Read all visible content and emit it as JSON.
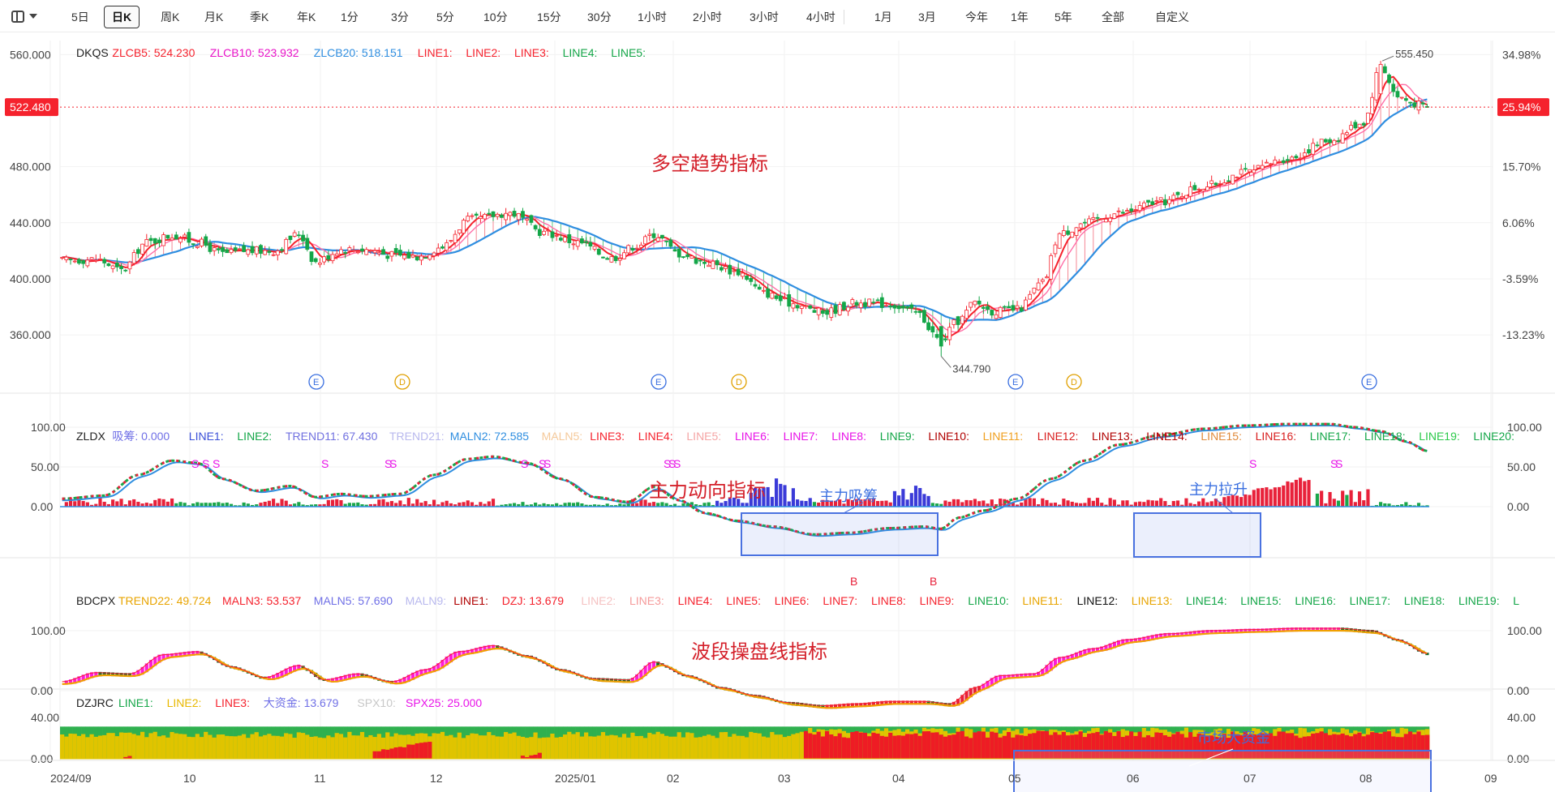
{
  "toolbar": {
    "periods": [
      "5日",
      "日K",
      "周K",
      "月K",
      "季K",
      "年K",
      "1分",
      "3分",
      "5分",
      "10分",
      "15分",
      "30分",
      "1小时",
      "2小时",
      "3小时",
      "4小时"
    ],
    "active": "日K",
    "ranges": [
      "1月",
      "3月",
      "今年",
      "1年",
      "5年",
      "全部",
      "自定义"
    ]
  },
  "colors": {
    "up": "#f5222d",
    "down": "#14a648",
    "ma5": "#f5222d",
    "ma10": "#e74c8b",
    "ma20": "#2f8ee0",
    "accent_blue": "#3a6fe0",
    "magenta": "#e812e8"
  },
  "main_panel": {
    "legend": [
      {
        "text": "DKQS",
        "color": "#222"
      },
      {
        "text": "ZLCB5: 524.230",
        "color": "#f5222d"
      },
      {
        "text": "ZLCB10: 523.932",
        "color": "#e812c8"
      },
      {
        "text": "ZLCB20: 518.151",
        "color": "#2f8ee0"
      },
      {
        "text": "LINE1:",
        "color": "#f5222d"
      },
      {
        "text": "LINE2:",
        "color": "#f5222d"
      },
      {
        "text": "LINE3:",
        "color": "#f5222d"
      },
      {
        "text": "LINE4:",
        "color": "#14a648"
      },
      {
        "text": "LINE5:",
        "color": "#14a648"
      }
    ],
    "title": "多空趋势指标",
    "y_ticks": [
      "560.000",
      "480.000",
      "440.000",
      "400.000",
      "360.000"
    ],
    "pct_ticks": [
      "34.98%",
      "15.70%",
      "6.06%",
      "-3.59%",
      "-13.23%"
    ],
    "current_price": "522.480",
    "current_pct": "25.94%",
    "high_label": "555.450",
    "low_label": "344.790",
    "event_markers": [
      "E",
      "D",
      "E",
      "D",
      "E",
      "D",
      "E"
    ]
  },
  "zldx_panel": {
    "legend": [
      {
        "text": "ZLDX",
        "color": "#222"
      },
      {
        "text": "吸筹: 0.000",
        "color": "#6f6fe6"
      },
      {
        "text": "LINE1:",
        "color": "#3a4fd8"
      },
      {
        "text": "LINE2:",
        "color": "#14a648"
      },
      {
        "text": "TREND11: 67.430",
        "color": "#7070e0"
      },
      {
        "text": "TREND21:",
        "color": "#b9b9ee"
      },
      {
        "text": "MALN2: 72.585",
        "color": "#2f8ee0"
      },
      {
        "text": "MALN5:",
        "color": "#f5c99a"
      },
      {
        "text": "LINE3:",
        "color": "#f5222d"
      },
      {
        "text": "LINE4:",
        "color": "#f5222d"
      },
      {
        "text": "LINE5:",
        "color": "#f5a5a5"
      },
      {
        "text": "LINE6:",
        "color": "#e812e8"
      },
      {
        "text": "LINE7:",
        "color": "#e812e8"
      },
      {
        "text": "LINE8:",
        "color": "#e812e8"
      },
      {
        "text": "LINE9:",
        "color": "#14a648"
      },
      {
        "text": "LINE10:",
        "color": "#b00000"
      },
      {
        "text": "LINE11:",
        "color": "#f0a020"
      },
      {
        "text": "LINE12:",
        "color": "#d81e1e"
      },
      {
        "text": "LINE13:",
        "color": "#b00000"
      },
      {
        "text": "LINE14:",
        "color": "#b00000"
      },
      {
        "text": "LINE15:",
        "color": "#e08a3a"
      },
      {
        "text": "LINE16:",
        "color": "#d81e1e"
      },
      {
        "text": "LINE17:",
        "color": "#14a648"
      },
      {
        "text": "LINE18:",
        "color": "#14a648"
      },
      {
        "text": "LINE19:",
        "color": "#2bc94a"
      },
      {
        "text": "LINE20:",
        "color": "#14a648"
      }
    ],
    "title": "主力动向指标",
    "y_ticks": [
      "100.00",
      "50.00",
      "0.00"
    ],
    "box_labels": [
      "主力吸筹",
      "主力拉升"
    ],
    "signal_s": "S",
    "signal_b": "B"
  },
  "bdcpx_panel": {
    "legend": [
      {
        "text": "BDCPX",
        "color": "#222"
      },
      {
        "text": "TREND22: 49.724",
        "color": "#e8a400"
      },
      {
        "text": "MALN3: 53.537",
        "color": "#f5222d"
      },
      {
        "text": "MALN5: 57.690",
        "color": "#6f6fe6"
      },
      {
        "text": "MALN9:",
        "color": "#b9b9ee"
      },
      {
        "text": "LINE1:",
        "color": "#b00000"
      },
      {
        "text": "DZJ: 13.679",
        "color": "#f5222d"
      },
      {
        "text": "LINE2:",
        "color": "#f5c2c2"
      },
      {
        "text": "LINE3:",
        "color": "#f59a9a"
      },
      {
        "text": "LINE4:",
        "color": "#f5222d"
      },
      {
        "text": "LINE5:",
        "color": "#f5222d"
      },
      {
        "text": "LINE6:",
        "color": "#f5222d"
      },
      {
        "text": "LINE7:",
        "color": "#f5222d"
      },
      {
        "text": "LINE8:",
        "color": "#f5222d"
      },
      {
        "text": "LINE9:",
        "color": "#f5222d"
      },
      {
        "text": "LINE10:",
        "color": "#14a648"
      },
      {
        "text": "LINE11:",
        "color": "#e8a400"
      },
      {
        "text": "LINE12:",
        "color": "#111"
      },
      {
        "text": "LINE13:",
        "color": "#e8a400"
      },
      {
        "text": "LINE14:",
        "color": "#14a648"
      },
      {
        "text": "LINE15:",
        "color": "#14a648"
      },
      {
        "text": "LINE16:",
        "color": "#14a648"
      },
      {
        "text": "LINE17:",
        "color": "#14a648"
      },
      {
        "text": "LINE18:",
        "color": "#14a648"
      },
      {
        "text": "LINE19:",
        "color": "#14a648"
      },
      {
        "text": "L",
        "color": "#14a648"
      }
    ],
    "title": "波段操盘线指标",
    "y_ticks": [
      "100.00",
      "0.00"
    ]
  },
  "dzjrc_panel": {
    "legend": [
      {
        "text": "DZJRC",
        "color": "#222"
      },
      {
        "text": "LINE1:",
        "color": "#14a648"
      },
      {
        "text": "LINE2:",
        "color": "#e8b800"
      },
      {
        "text": "LINE3:",
        "color": "#f5222d"
      },
      {
        "text": "大资金: 13.679",
        "color": "#6f6fe6"
      },
      {
        "text": "SPX10:",
        "color": "#c8c8c8"
      },
      {
        "text": "SPX25: 25.000",
        "color": "#e812e8"
      }
    ],
    "box_label": "市场大资金",
    "y_ticks": [
      "40.00",
      "0.00"
    ]
  },
  "x_axis": {
    "labels": [
      "2024/09",
      "10",
      "11",
      "12",
      "2025/01",
      "02",
      "03",
      "04",
      "05",
      "06",
      "07",
      "08",
      "09"
    ]
  },
  "chart_data": {
    "type": "candlestick-with-indicators",
    "price_series_name": "DKQS",
    "price_anchors": [
      [
        0,
        413
      ],
      [
        8,
        414
      ],
      [
        14,
        406
      ],
      [
        20,
        426
      ],
      [
        26,
        431
      ],
      [
        32,
        426
      ],
      [
        38,
        418
      ],
      [
        44,
        420
      ],
      [
        50,
        420
      ],
      [
        56,
        432
      ],
      [
        60,
        412
      ],
      [
        66,
        421
      ],
      [
        72,
        421
      ],
      [
        78,
        417
      ],
      [
        84,
        416
      ],
      [
        90,
        423
      ],
      [
        96,
        442
      ],
      [
        106,
        447
      ],
      [
        114,
        433
      ],
      [
        122,
        426
      ],
      [
        130,
        415
      ],
      [
        136,
        424
      ],
      [
        140,
        432
      ],
      [
        146,
        418
      ],
      [
        152,
        412
      ],
      [
        160,
        405
      ],
      [
        166,
        390
      ],
      [
        172,
        383
      ],
      [
        180,
        376
      ],
      [
        188,
        383
      ],
      [
        196,
        382
      ],
      [
        202,
        376
      ],
      [
        208,
        356
      ],
      [
        212,
        370
      ],
      [
        216,
        383
      ],
      [
        220,
        377
      ],
      [
        226,
        378
      ],
      [
        232,
        397
      ],
      [
        236,
        432
      ],
      [
        242,
        440
      ],
      [
        250,
        447
      ],
      [
        260,
        455
      ],
      [
        270,
        466
      ],
      [
        280,
        476
      ],
      [
        290,
        486
      ],
      [
        300,
        499
      ],
      [
        308,
        512
      ],
      [
        312,
        552
      ],
      [
        316,
        530
      ],
      [
        320,
        525
      ],
      [
        323,
        522
      ]
    ],
    "ylim": [
      330,
      570
    ],
    "current_price": 522.48,
    "high": 555.45,
    "low": 344.79,
    "zldx_anchors": [
      [
        0,
        10
      ],
      [
        10,
        14
      ],
      [
        18,
        40
      ],
      [
        26,
        58
      ],
      [
        32,
        55
      ],
      [
        38,
        35
      ],
      [
        46,
        20
      ],
      [
        54,
        26
      ],
      [
        60,
        12
      ],
      [
        66,
        16
      ],
      [
        72,
        13
      ],
      [
        80,
        16
      ],
      [
        88,
        40
      ],
      [
        96,
        60
      ],
      [
        102,
        63
      ],
      [
        110,
        55
      ],
      [
        118,
        35
      ],
      [
        126,
        12
      ],
      [
        134,
        6
      ],
      [
        140,
        25
      ],
      [
        146,
        8
      ],
      [
        152,
        -8
      ],
      [
        160,
        -18
      ],
      [
        168,
        -25
      ],
      [
        178,
        -35
      ],
      [
        186,
        -33
      ],
      [
        196,
        -27
      ],
      [
        204,
        -25
      ],
      [
        208,
        -28
      ],
      [
        212,
        -14
      ],
      [
        218,
        -5
      ],
      [
        226,
        10
      ],
      [
        234,
        35
      ],
      [
        242,
        58
      ],
      [
        250,
        78
      ],
      [
        260,
        90
      ],
      [
        270,
        98
      ],
      [
        280,
        102
      ],
      [
        290,
        104
      ],
      [
        300,
        104
      ],
      [
        306,
        100
      ],
      [
        312,
        95
      ],
      [
        318,
        82
      ],
      [
        323,
        70
      ]
    ],
    "zldx_ylim": [
      -60,
      120
    ],
    "bdcpx_anchors": [
      [
        0,
        15
      ],
      [
        8,
        30
      ],
      [
        16,
        28
      ],
      [
        24,
        60
      ],
      [
        32,
        65
      ],
      [
        40,
        40
      ],
      [
        48,
        22
      ],
      [
        56,
        42
      ],
      [
        62,
        18
      ],
      [
        70,
        28
      ],
      [
        78,
        15
      ],
      [
        86,
        35
      ],
      [
        94,
        65
      ],
      [
        102,
        75
      ],
      [
        110,
        58
      ],
      [
        118,
        35
      ],
      [
        126,
        20
      ],
      [
        134,
        18
      ],
      [
        140,
        48
      ],
      [
        148,
        25
      ],
      [
        156,
        5
      ],
      [
        164,
        -8
      ],
      [
        172,
        -20
      ],
      [
        180,
        -25
      ],
      [
        188,
        -22
      ],
      [
        196,
        -18
      ],
      [
        204,
        -18
      ],
      [
        210,
        -22
      ],
      [
        216,
        5
      ],
      [
        222,
        25
      ],
      [
        230,
        28
      ],
      [
        236,
        55
      ],
      [
        244,
        70
      ],
      [
        252,
        85
      ],
      [
        262,
        95
      ],
      [
        272,
        100
      ],
      [
        282,
        102
      ],
      [
        292,
        104
      ],
      [
        302,
        104
      ],
      [
        310,
        100
      ],
      [
        316,
        85
      ],
      [
        323,
        62
      ]
    ],
    "bdcpx_ylim": [
      -40,
      125
    ],
    "dzjrc_ylim": [
      0,
      44
    ]
  }
}
